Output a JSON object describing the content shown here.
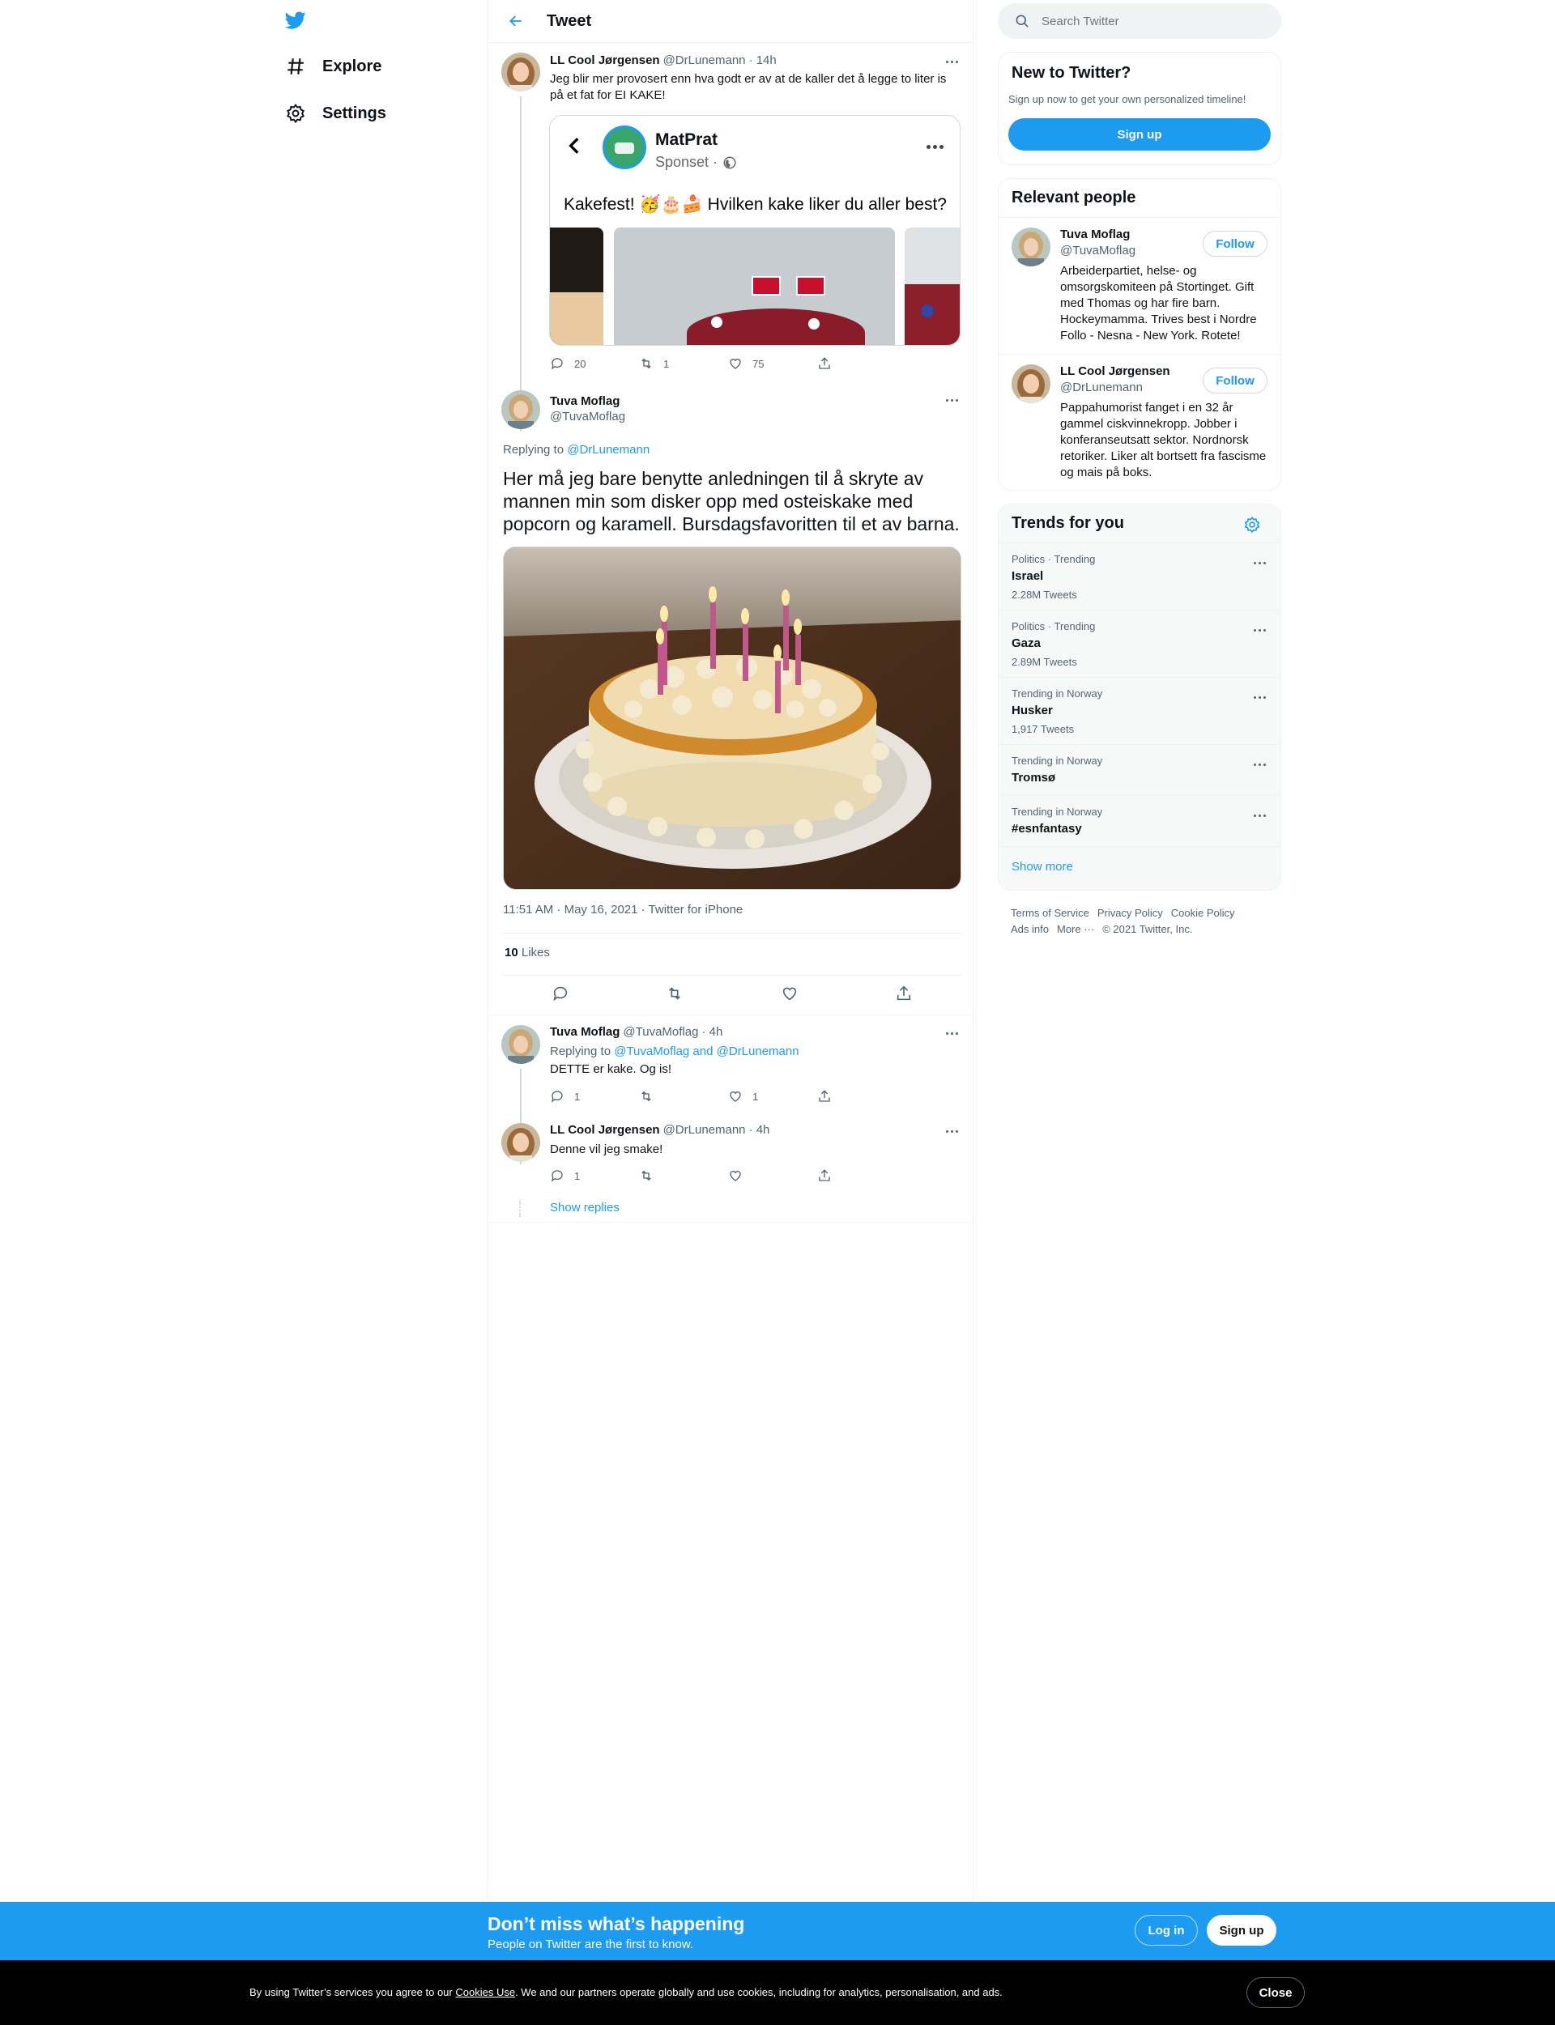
{
  "nav": {
    "explore": "Explore",
    "settings": "Settings"
  },
  "header": {
    "title": "Tweet"
  },
  "thread": [
    {
      "name": "LL Cool Jørgensen",
      "handle": "@DrLunemann",
      "time": "· 14h",
      "text": "Jeg blir mer provosert enn hva godt er av at de kaller det å legge to liter is på et fat for EI KAKE!",
      "card": {
        "brand": "MatPrat",
        "subtitle": "Sponset ·",
        "caption": "Kakefest! 🥳🎂🍰 Hvilken kake liker du aller best?"
      },
      "replies": "20",
      "retweets": "1",
      "likes": "75"
    }
  ],
  "main_tweet": {
    "name": "Tuva Moflag",
    "handle": "@TuvaMoflag",
    "replying_prefix": "Replying to",
    "replying_to": "@DrLunemann",
    "text": "Her må jeg bare benytte anledningen til å skryte av mannen min som disker opp med osteiskake med popcorn og karamell. Bursdagsfavoritten til et av barna.",
    "meta": "11:51 AM · May 16, 2021 · Twitter for iPhone",
    "likes_count": "10",
    "likes_label": "Likes"
  },
  "replies": [
    {
      "name": "Tuva Moflag",
      "handle": "@TuvaMoflag",
      "time": "· 4h",
      "replying_prefix": "Replying to",
      "replying_to": "@TuvaMoflag and @DrLunemann",
      "text": "DETTE er kake. Og is!",
      "replies": "1",
      "retweets": "",
      "likes": "1"
    },
    {
      "name": "LL Cool Jørgensen",
      "handle": "@DrLunemann",
      "time": "· 4h",
      "text": "Denne vil jeg smake!",
      "replies": "1",
      "retweets": "",
      "likes": ""
    }
  ],
  "show_replies": "Show replies",
  "search": {
    "placeholder": "Search Twitter"
  },
  "new_to_twitter": {
    "title": "New to Twitter?",
    "subtitle": "Sign up now to get your own personalized timeline!",
    "button": "Sign up"
  },
  "relevant": {
    "title": "Relevant people",
    "people": [
      {
        "name": "Tuva Moflag",
        "handle": "@TuvaMoflag",
        "bio": "Arbeiderpartiet, helse- og omsorgskomiteen på Stortinget. Gift med Thomas og har fire barn. Hockeymamma. Trives best i Nordre Follo - Nesna - New York. Rotete!",
        "button": "Follow"
      },
      {
        "name": "LL Cool Jørgensen",
        "handle": "@DrLunemann",
        "bio": "Pappahumorist fanget i en 32 år gammel ciskvinnekropp. Jobber i konferanseutsatt sektor. Nordnorsk retoriker. Liker alt bortsett fra fascisme og mais på boks.",
        "button": "Follow"
      }
    ]
  },
  "trends": {
    "title": "Trends for you",
    "items": [
      {
        "context": "Politics · Trending",
        "name": "Israel",
        "count": "2.28M Tweets"
      },
      {
        "context": "Politics · Trending",
        "name": "Gaza",
        "count": "2.89M Tweets"
      },
      {
        "context": "Trending in Norway",
        "name": "Husker",
        "count": "1,917 Tweets"
      },
      {
        "context": "Trending in Norway",
        "name": "Tromsø",
        "count": ""
      },
      {
        "context": "Trending in Norway",
        "name": "#esnfantasy",
        "count": ""
      }
    ],
    "show_more": "Show more"
  },
  "footer": {
    "links": [
      "Terms of Service",
      "Privacy Policy",
      "Cookie Policy",
      "Ads info",
      "More ···"
    ],
    "copyright": "© 2021 Twitter, Inc."
  },
  "bottom_bar": {
    "title": "Don’t miss what’s happening",
    "subtitle": "People on Twitter are the first to know.",
    "login": "Log in",
    "signup": "Sign up"
  },
  "cookie": {
    "prefix": "By using Twitter’s services you agree to our ",
    "link": "Cookies Use",
    "suffix": ". We and our partners operate globally and use cookies, including for analytics, personalisation, and ads.",
    "close": "Close"
  },
  "colors": {
    "accent": "#1d9bf0",
    "text": "#0f1419",
    "muted": "#536471",
    "border": "#eff3f4"
  }
}
